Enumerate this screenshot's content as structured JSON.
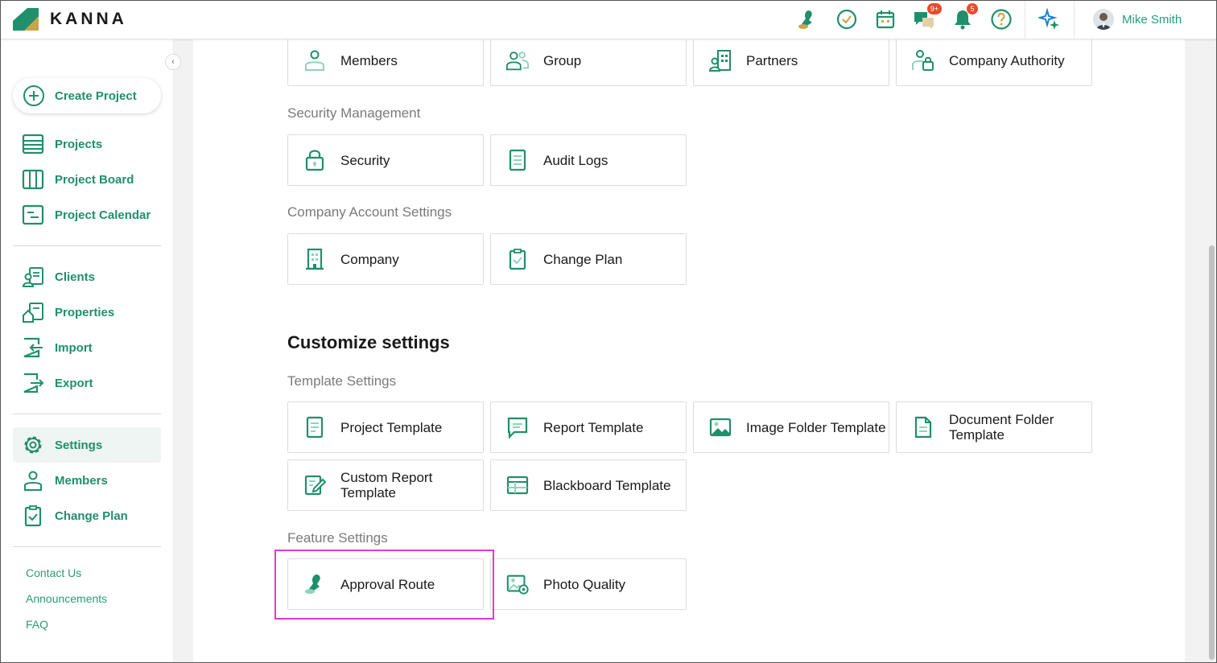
{
  "app": {
    "brand": "KANNA"
  },
  "header": {
    "user_name": "Mike Smith",
    "chat_badge": "9+",
    "notif_badge": "5",
    "icons": [
      "stamp-icon",
      "check-circle-icon",
      "calendar-icon",
      "chat-icon",
      "bell-icon",
      "help-icon",
      "sparkle-icon"
    ]
  },
  "sidebar": {
    "create_label": "Create Project",
    "group1": [
      "Projects",
      "Project Board",
      "Project Calendar"
    ],
    "group2": [
      "Clients",
      "Properties",
      "Import",
      "Export"
    ],
    "group3": [
      "Settings",
      "Members",
      "Change Plan"
    ],
    "active": "Settings",
    "footer": [
      "Contact Us",
      "Announcements",
      "FAQ"
    ]
  },
  "main": {
    "top_cards": [
      "Members",
      "Group",
      "Partners",
      "Company Authority"
    ],
    "security_heading": "Security Management",
    "security_cards": [
      "Security",
      "Audit Logs"
    ],
    "account_heading": "Company Account Settings",
    "account_cards": [
      "Company",
      "Change Plan"
    ],
    "customize_heading": "Customize settings",
    "template_heading": "Template Settings",
    "template_cards": [
      "Project Template",
      "Report Template",
      "Image Folder Template",
      "Document Folder Template",
      "Custom Report Template",
      "Blackboard Template"
    ],
    "feature_heading": "Feature Settings",
    "feature_cards": [
      "Approval Route",
      "Photo Quality"
    ]
  },
  "colors": {
    "brand_green": "#1f8f6c",
    "accent_green": "#22a07a",
    "badge_red": "#e94a2c",
    "highlight": "#e03ad9",
    "logo_gold": "#c9a648"
  }
}
